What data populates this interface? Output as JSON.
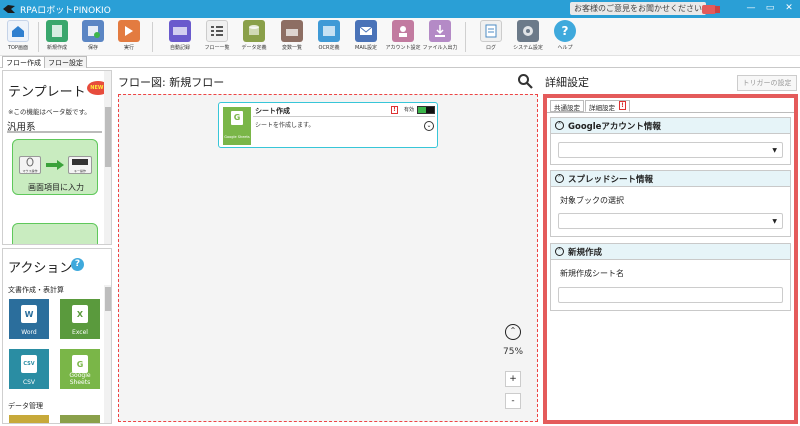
{
  "window": {
    "title": "RPAロボットPINOKIO",
    "feedback_label": "お客様のご意見をお聞かせください",
    "controls": [
      "—",
      "▭",
      "✕"
    ]
  },
  "toolbar": {
    "items": [
      {
        "label": "TOP画面",
        "icon": "home-icon",
        "color": "#2f7fcf"
      },
      {
        "label": "新規作成",
        "icon": "new-file-icon",
        "color": "#3aa76d"
      },
      {
        "label": "保存",
        "icon": "save-icon",
        "color": "#5b86c4"
      },
      {
        "label": "実行",
        "icon": "run-icon",
        "color": "#e37b40"
      },
      {
        "label": "自動記録",
        "icon": "record-icon",
        "color": "#6a5acd"
      },
      {
        "label": "フロー一覧",
        "icon": "flow-list-icon",
        "color": "#777777"
      },
      {
        "label": "データ定義",
        "icon": "database-icon",
        "color": "#8aa04a"
      },
      {
        "label": "変数一覧",
        "icon": "variables-icon",
        "color": "#8d6e63"
      },
      {
        "label": "OCR定義",
        "icon": "ocr-icon",
        "color": "#3f9ad6"
      },
      {
        "label": "MAIL設定",
        "icon": "mail-icon",
        "color": "#4a73b8"
      },
      {
        "label": "アカウント設定",
        "icon": "account-icon",
        "color": "#c27ba0"
      },
      {
        "label": "ファイル入出力",
        "icon": "file-io-icon",
        "color": "#b48ac6"
      },
      {
        "label": "ログ",
        "icon": "log-icon",
        "color": "#4c8bc4"
      },
      {
        "label": "システム設定",
        "icon": "gear-icon",
        "color": "#6c7a89"
      },
      {
        "label": "ヘルプ",
        "icon": "help-icon",
        "color": "#3fa9dc"
      }
    ]
  },
  "tabs": {
    "flow_create": "フロー作成",
    "flow_settings": "フロー設定"
  },
  "template_panel": {
    "title": "テンプレート",
    "new_badge": "NEW!",
    "beta_note": "※この機能はベータ版です。",
    "category": "汎用系",
    "card1": {
      "label": "画面項目に入力",
      "left_caption": "マウス操作",
      "right_caption": "キー操作"
    }
  },
  "action_panel": {
    "title": "アクション",
    "help_glyph": "?",
    "doc_category": "文書作成・表計算",
    "tiles": [
      {
        "label": "Word",
        "glyph": "W",
        "color": "#2b6e9c"
      },
      {
        "label": "Excel",
        "glyph": "X",
        "color": "#5a9a3d"
      },
      {
        "label": "CSV",
        "glyph": "CSV",
        "color": "#2a8da3"
      },
      {
        "label": "Google Sheets",
        "glyph": "G",
        "color": "#7ab648"
      }
    ],
    "data_category": "データ管理"
  },
  "flow": {
    "title": "フロー図:  新規フロー",
    "node": {
      "title": "シート作成",
      "description": "シートを作成します。",
      "icon_label": "Google Sheets",
      "icon_glyph": "G",
      "warning_glyph": "!",
      "enabled_label": "有効",
      "expand_glyph": "⌄"
    },
    "zoom_level": "75%",
    "zoom_up_glyph": "⌃",
    "zoom_in": "+",
    "zoom_out": "-"
  },
  "detail": {
    "title": "詳細設定",
    "trigger_button": "トリガーの設定",
    "tabs": {
      "common": "共通設定",
      "detail": "詳細設定",
      "warning_glyph": "!"
    },
    "sections": {
      "google_account": {
        "title": "Googleアカウント情報"
      },
      "spreadsheet": {
        "title": "スプレッドシート情報",
        "field_label": "対象ブックの選択"
      },
      "new_create": {
        "title": "新規作成",
        "field_label": "新規作成シート名",
        "value": ""
      }
    },
    "chevron_glyph": "⌃",
    "select_arrow": "▼"
  }
}
